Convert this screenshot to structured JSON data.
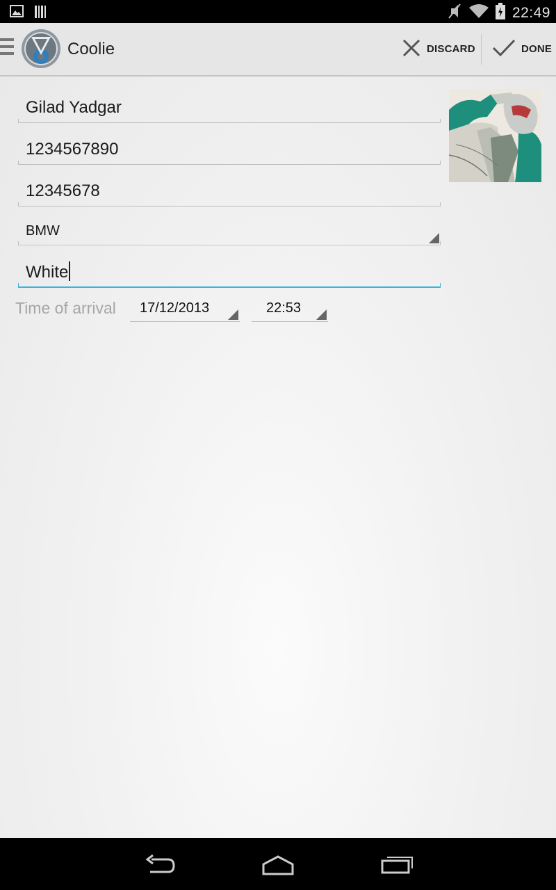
{
  "status_bar": {
    "time": "22:49"
  },
  "action_bar": {
    "title": "Coolie",
    "discard_label": "DISCARD",
    "done_label": "DONE"
  },
  "form": {
    "name": "Gilad Yadgar",
    "phone": "1234567890",
    "id_number": "12345678",
    "car_make": "BMW",
    "car_color": "White",
    "time_of_arrival_label": "Time of arrival",
    "arrival_date": "17/12/2013",
    "arrival_time": "22:53"
  },
  "colors": {
    "accent": "#33b5e5",
    "action_bar_bg": "#e6e6e6"
  },
  "icons": [
    "gallery-icon",
    "barcode-icon",
    "mute-icon",
    "wifi-icon",
    "battery-charging-icon",
    "menu-icon",
    "app-logo-icon",
    "close-icon",
    "check-icon",
    "back-icon",
    "home-icon",
    "recent-apps-icon"
  ]
}
